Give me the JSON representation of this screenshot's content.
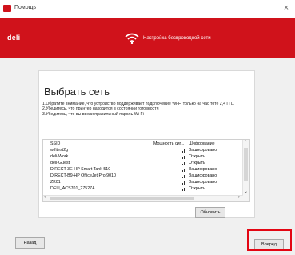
{
  "window": {
    "title": "Помощь",
    "close_glyph": "×"
  },
  "banner": {
    "logo": "deli",
    "title": "Настройка беспроводной сети",
    "wifi_icon": "wifi-icon",
    "color": "#d0121b"
  },
  "main": {
    "heading": "Выбрать сеть",
    "notes": [
      "1.Обратите внимание, что устройство поддерживает подключение Wi-Fi только на час тоте 2,4 ГГц.",
      "2.Убедитесь, что принтер находится в состоянии готовности",
      "3.Убедитесь, что вы ввели правильный пароль Wi-Fi"
    ]
  },
  "networks": {
    "columns": {
      "ssid": "SSID",
      "signal": "Мощность сиг...",
      "security": "Шифрование"
    },
    "rows": [
      {
        "ssid": "wifitest2g",
        "security": "Зашифровано"
      },
      {
        "ssid": "deli-Work",
        "security": "Открыть"
      },
      {
        "ssid": "deli-Guest",
        "security": "Открыть"
      },
      {
        "ssid": "DIRECT-3E-HP Smart Tank 510",
        "security": "Зашифровано"
      },
      {
        "ssid": "DIRECT-B9-HP OfficeJet Pro 9010",
        "security": "Зашифровано"
      },
      {
        "ssid": "ZK01",
        "security": "Зашифровано"
      },
      {
        "ssid": "DELI_ACS701_27527A",
        "security": "Открыть"
      }
    ]
  },
  "buttons": {
    "refresh": "Обновить",
    "back": "Назад",
    "next": "Вперед"
  },
  "highlight_color": "#e30613"
}
